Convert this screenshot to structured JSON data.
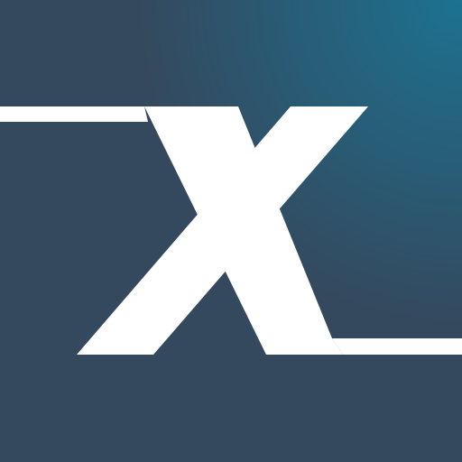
{
  "icon": {
    "name": "x-logo-icon",
    "colors": {
      "background_base": "#34495e",
      "background_accent": "#1c7291",
      "mark": "#ffffff"
    }
  }
}
